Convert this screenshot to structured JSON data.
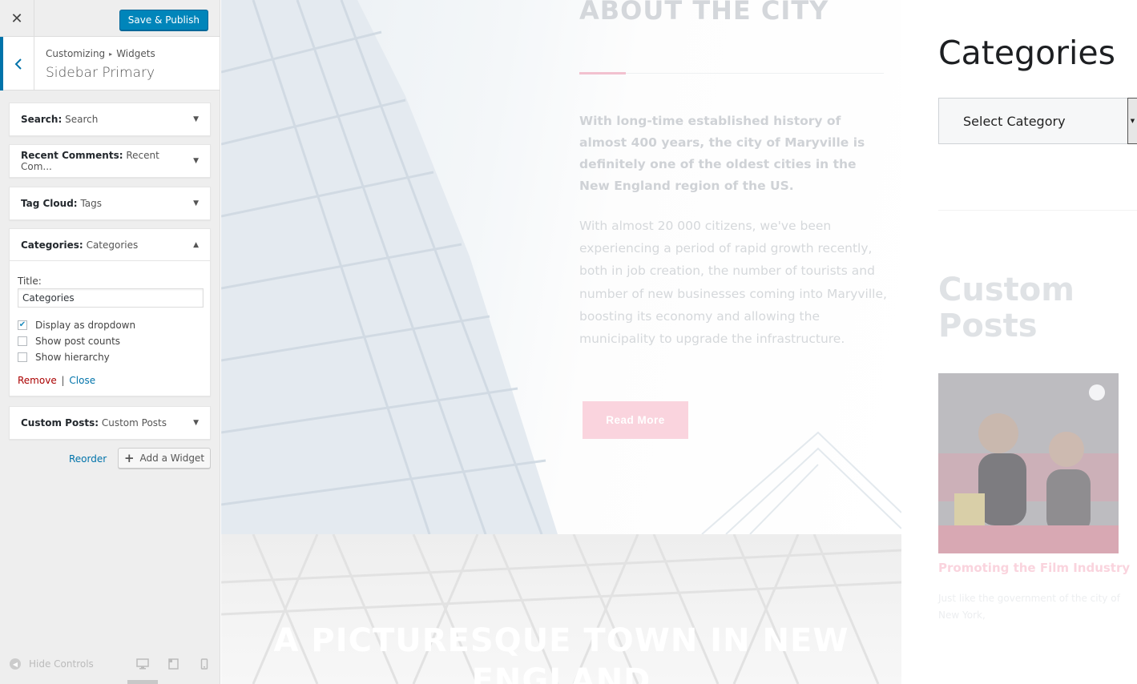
{
  "topbar": {
    "close_label": "✕",
    "publish_label": "Save & Publish",
    "primary_color": "#0085ba"
  },
  "section": {
    "breadcrumb_root": "Customizing",
    "breadcrumb_child": "Widgets",
    "breadcrumb_sep": "▸",
    "title": "Sidebar Primary",
    "back_icon": "chevron-left-icon"
  },
  "widgets": [
    {
      "name": "Search:",
      "title": "Search",
      "expanded": false
    },
    {
      "name": "Recent Comments:",
      "title": "Recent Com...",
      "expanded": false
    },
    {
      "name": "Tag Cloud:",
      "title": "Tags",
      "expanded": false
    },
    {
      "name": "Categories:",
      "title": "Categories",
      "expanded": true
    },
    {
      "name": "Custom Posts:",
      "title": "Custom Posts",
      "expanded": false
    }
  ],
  "categories_form": {
    "title_label": "Title:",
    "title_value": "Categories",
    "options": [
      {
        "label": "Display as dropdown",
        "checked": true
      },
      {
        "label": "Show post counts",
        "checked": false
      },
      {
        "label": "Show hierarchy",
        "checked": false
      }
    ],
    "remove_label": "Remove",
    "pipe": "|",
    "close_label": "Close"
  },
  "panel_actions": {
    "reorder_label": "Reorder",
    "add_widget_label": "Add a Widget",
    "add_icon": "+"
  },
  "footer": {
    "hide_controls_label": "Hide Controls",
    "devices": [
      "desktop-icon",
      "tablet-icon",
      "mobile-icon"
    ]
  },
  "preview": {
    "about": {
      "title": "ABOUT THE CITY",
      "lead": "With long-time established history of almost 400 years, the city of Maryville is definitely one of the oldest cities in the New England region of the US.",
      "body": "With almost 20 000 citizens, we've been experiencing a period of rapid growth recently, both in job creation, the number of tourists and number of new businesses coming into Maryville, boosting its economy and allowing the municipality to upgrade the infrastructure.",
      "button": "Read More",
      "accent_color": "#f2c1cf"
    },
    "band_title": "A PICTURESQUE TOWN IN NEW ENGLAND",
    "sidebar": {
      "categories_heading": "Categories",
      "select_label": "Select Category",
      "custom_posts_heading": "Custom Posts",
      "post_title": "Promoting the Film Industry",
      "post_excerpt": "Just like the government of the city of New York,"
    }
  }
}
